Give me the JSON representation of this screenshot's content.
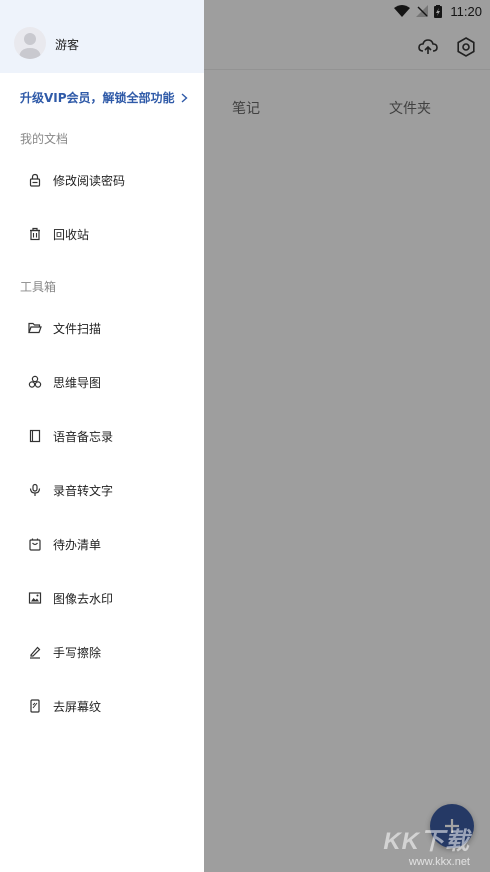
{
  "status_bar": {
    "time": "11:20"
  },
  "main": {
    "tabs": [
      {
        "label": "笔记"
      },
      {
        "label": "文件夹"
      }
    ]
  },
  "drawer": {
    "username": "游客",
    "vip_promo": "升级VIP会员，解锁全部功能",
    "sections": [
      {
        "label": "我的文档",
        "items": [
          {
            "label": "修改阅读密码",
            "icon": "lock-icon"
          },
          {
            "label": "回收站",
            "icon": "trash-icon"
          }
        ]
      },
      {
        "label": "工具箱",
        "items": [
          {
            "label": "文件扫描",
            "icon": "folder-open-icon"
          },
          {
            "label": "思维导图",
            "icon": "mindmap-icon"
          },
          {
            "label": "语音备忘录",
            "icon": "notebook-icon"
          },
          {
            "label": "录音转文字",
            "icon": "microphone-icon"
          },
          {
            "label": "待办清单",
            "icon": "todo-bag-icon"
          },
          {
            "label": "图像去水印",
            "icon": "image-icon"
          },
          {
            "label": "手写擦除",
            "icon": "pen-icon"
          },
          {
            "label": "去屏幕纹",
            "icon": "phone-screen-icon"
          }
        ]
      }
    ]
  },
  "watermark": {
    "brand": "KK下载",
    "url": "www.kkx.net"
  },
  "colors": {
    "accent": "#3a5a9e",
    "vip_text": "#2f5aa8",
    "header_bg": "#eef3fb"
  }
}
